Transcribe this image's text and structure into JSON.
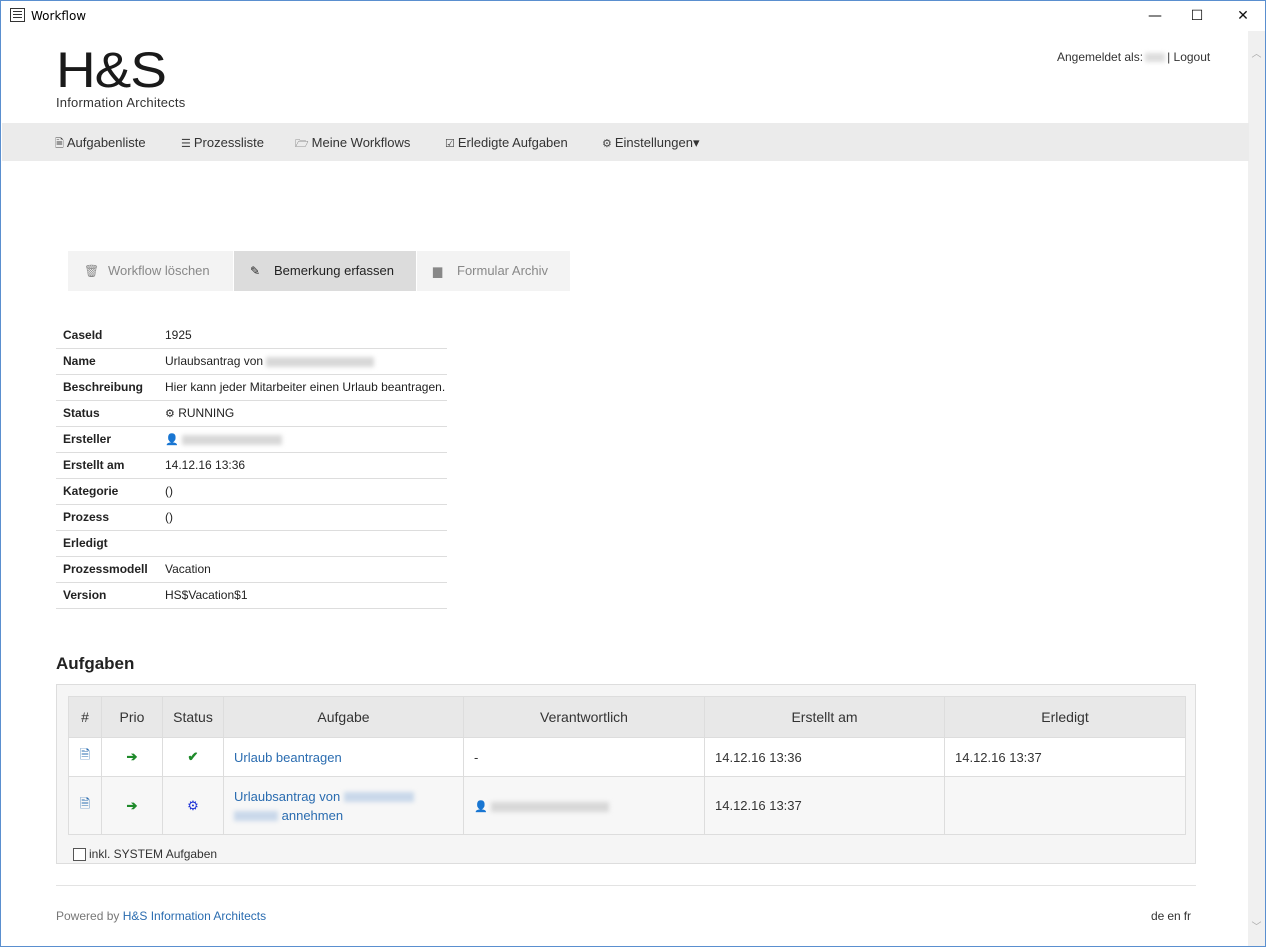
{
  "window": {
    "title": "Workflow",
    "minimize": "—",
    "maximize": "☐",
    "close": "✕"
  },
  "header": {
    "logo_mark": "H&S",
    "logo_sub": "Information Architects",
    "logged_in_label": "Angemeldet als:",
    "separator": "|",
    "logout": "Logout"
  },
  "nav": {
    "items": [
      {
        "label": "Aufgabenliste",
        "icon": "document-icon"
      },
      {
        "label": "Prozessliste",
        "icon": "list-icon"
      },
      {
        "label": "Meine Workflows",
        "icon": "folder-open-icon"
      },
      {
        "label": "Erledigte Aufgaben",
        "icon": "checkbox-icon"
      },
      {
        "label": "Einstellungen",
        "icon": "gear-icon"
      }
    ],
    "caret": "▾"
  },
  "actions": {
    "delete": "Workflow löschen",
    "comment": "Bemerkung erfassen",
    "archive": "Formular Archiv"
  },
  "details": {
    "caseid": {
      "label": "CaseId",
      "value": "1925"
    },
    "name": {
      "label": "Name",
      "value": "Urlaubsantrag von"
    },
    "beschreibung": {
      "label": "Beschreibung",
      "value": "Hier kann jeder Mitarbeiter einen Urlaub beantragen."
    },
    "status": {
      "label": "Status",
      "value": "RUNNING"
    },
    "ersteller": {
      "label": "Ersteller",
      "value": ""
    },
    "erstellt": {
      "label": "Erstellt am",
      "value": "14.12.16 13:36"
    },
    "kategorie": {
      "label": "Kategorie",
      "value": "()"
    },
    "prozess": {
      "label": "Prozess",
      "value": "()"
    },
    "erledigt": {
      "label": "Erledigt",
      "value": ""
    },
    "prozessmodell": {
      "label": "Prozessmodell",
      "value": "Vacation"
    },
    "version": {
      "label": "Version",
      "value": "HS$Vacation$1"
    }
  },
  "tasks": {
    "heading": "Aufgaben",
    "columns": [
      "#",
      "Prio",
      "Status",
      "Aufgabe",
      "Verantwortlich",
      "Erstellt am",
      "Erledigt"
    ],
    "rows": [
      {
        "aufgabe": "Urlaub beantragen",
        "verantwortlich": "-",
        "erstellt": "14.12.16 13:36",
        "erledigt": "14.12.16 13:37",
        "status_icon": "check-icon"
      },
      {
        "aufgabe_a": "Urlaubsantrag von",
        "aufgabe_b": "annehmen",
        "verantwortlich": "",
        "erstellt": "14.12.16 13:37",
        "erledigt": "",
        "status_icon": "gear-icon"
      }
    ],
    "system_checkbox": "inkl. SYSTEM Aufgaben",
    "colors": {
      "link": "#2a6cb0",
      "arrow": "#1e8a2a",
      "check": "#1e8a2a",
      "gear": "#1a2fd6"
    }
  },
  "footer": {
    "powered_by": "Powered by",
    "powered_link": "H&S Information Architects",
    "langs": [
      "de",
      "en",
      "fr"
    ]
  }
}
